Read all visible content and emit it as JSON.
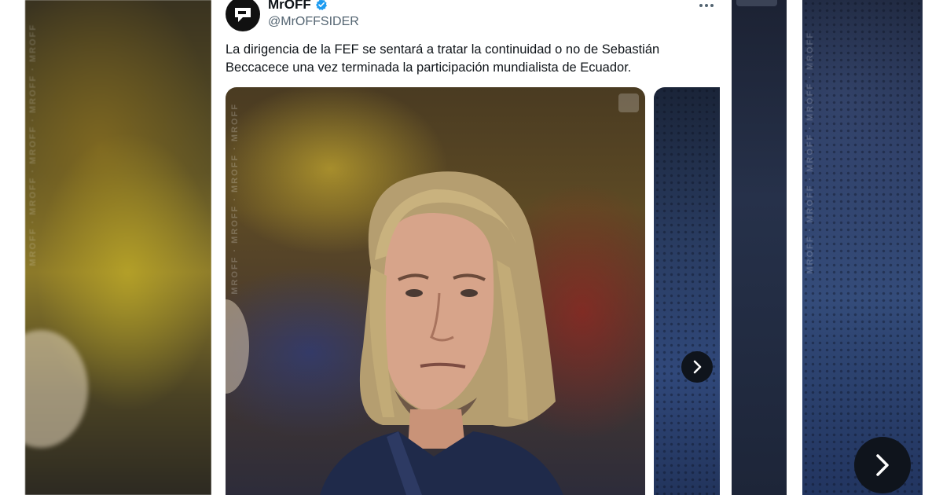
{
  "tweet": {
    "author_name": "MrOFF",
    "author_handle": "@MrOFFSIDER",
    "verified": true,
    "text": "La dirigencia de la FEF se sentará a tratar la continuidad o no de Sebastián Beccacece una vez terminada la participación mundialista de Ecuador.",
    "more_icon": "more-horizontal-icon"
  },
  "media": {
    "watermark": "MROFF · MROFF · MROFF · MROFF",
    "image_1": "photo-of-man-with-long-blond-hair",
    "image_2": "photo-of-blue-fabric",
    "next_icon": "chevron-right-icon"
  },
  "background": {
    "watermark": "MROFF · MROFF · MROFF · MROFF · MROFF"
  },
  "colors": {
    "verified_blue": "#1d9bf0",
    "text_primary": "#0f1419",
    "text_secondary": "#536471"
  }
}
